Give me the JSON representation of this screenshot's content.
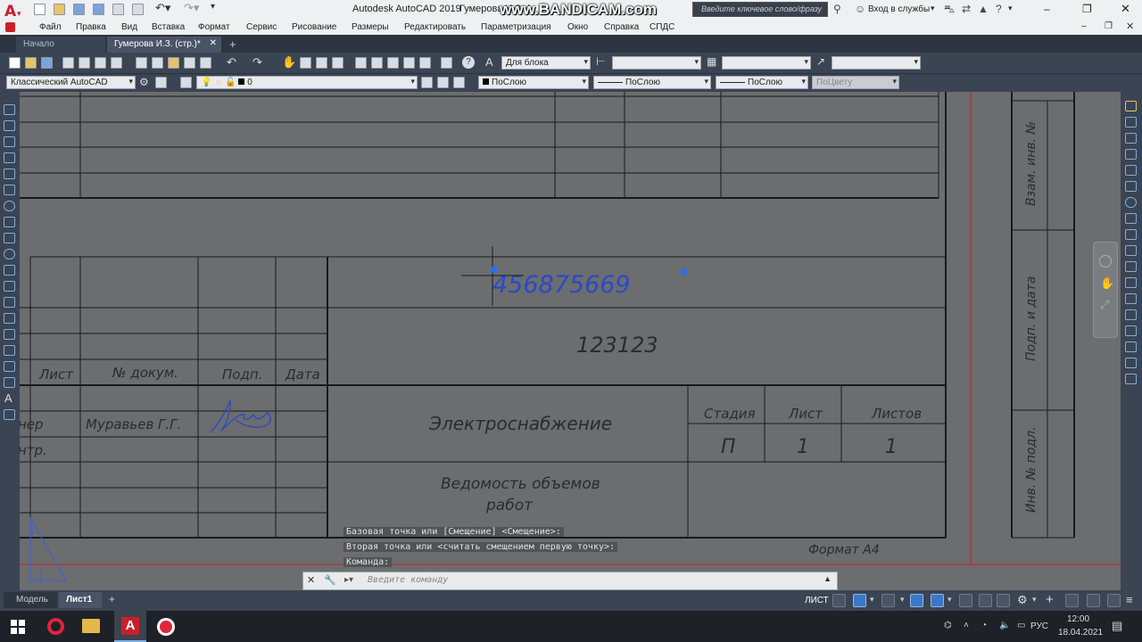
{
  "titlebar": {
    "app_title": "Autodesk AutoCAD 2019",
    "doc_title": "Гумерова И.З. (",
    "watermark": "www.BANDICAM.com",
    "search_placeholder": "Введите ключевое слово/фразу",
    "signin": "Вход в службы",
    "app_icon": "autocad-a-icon"
  },
  "menu": [
    "Файл",
    "Правка",
    "Вид",
    "Вставка",
    "Формат",
    "Сервис",
    "Рисование",
    "Размеры",
    "Редактировать",
    "Параметризация",
    "Окно",
    "Справка",
    "СПДС"
  ],
  "tabs": {
    "start": "Начало",
    "active": "Гумерова И.З. (стр.)*",
    "add": "+"
  },
  "toolbar1": {
    "block_style": "Для блока",
    "field2": "",
    "field3": "",
    "field4": ""
  },
  "toolbar2": {
    "workspace": "Классический AutoCAD",
    "layer": "0",
    "color": "ПоСлою",
    "linetype": "ПоСлою",
    "lineweight": "ПоСлою",
    "plotstyle": "ПоЦвету"
  },
  "drawing": {
    "code": "456875669",
    "number": "123123",
    "col_sheet": "Лист",
    "col_docnum": "№ докум.",
    "col_sign": "Подп.",
    "col_date": "Дата",
    "role_engineer": "нер",
    "role_control": "нтр.",
    "engineer_name": "Муравьев Г.Г.",
    "project_title": "Электроснабжение",
    "sheet_title_1": "Ведомость объемов",
    "sheet_title_2": "работ",
    "stage_label": "Стадия",
    "sheet_label": "Лист",
    "sheets_label": "Листов",
    "stage_value": "П",
    "sheet_value": "1",
    "sheets_value": "1",
    "format": "Формат А4",
    "side_1": "Взам. инв. №",
    "side_2": "Подп. и дата",
    "side_3": "Инв. № подл."
  },
  "command": {
    "line1": "Базовая точка или [Смещение] <Смещение>:",
    "line2": "Вторая точка или <считать смещением первую точку>:",
    "line3": "Команда:",
    "placeholder": "Введите команду"
  },
  "layout_tabs": {
    "model": "Модель",
    "sheet": "Лист1",
    "add": "+"
  },
  "status": {
    "mode": "ЛИСТ"
  },
  "taskbar": {
    "lang": "РУС",
    "time": "12:00",
    "date": "18.04.2021"
  },
  "colors": {
    "accent": "#3c78c8",
    "red_border": "#c8202a",
    "canvas": "#6b6d6f"
  }
}
